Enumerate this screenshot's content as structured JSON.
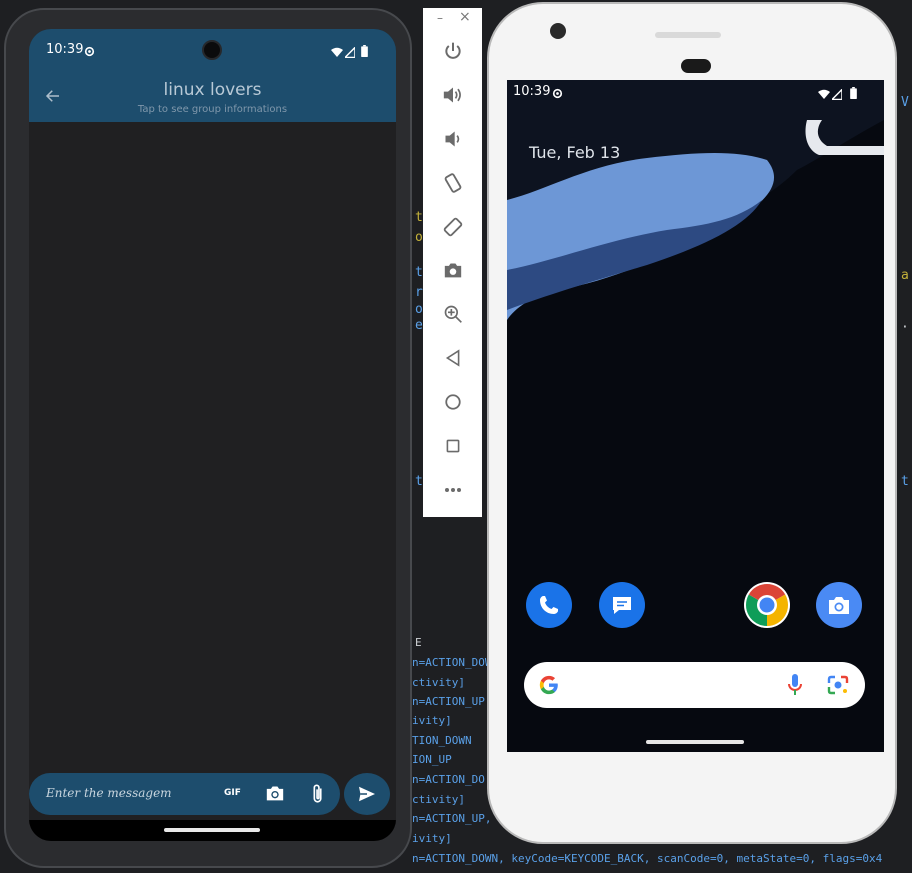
{
  "terminal": {
    "lines": [
      "E",
      "n=ACTION_DOWN",
      "ctivity]",
      "n=ACTION_UP",
      "ivity]",
      "TION_DOWN",
      "ION_UP",
      "n=ACTION_DO",
      "ctivity]",
      "n=ACTION_UP,",
      "ivity]",
      "n=ACTION_DOWN, keyCode=KEYCODE_BACK, scanCode=0, metaState=0, flags=0x4"
    ]
  },
  "chat_app": {
    "status": {
      "time": "10:39"
    },
    "group_name": "linux lovers",
    "group_subtitle": "Tap to see group informations",
    "input_placeholder": "Enter the messagem",
    "gif_label": "GIF"
  },
  "emulator_toolbar": {
    "minimize": "–",
    "close": "×",
    "buttons": [
      "power",
      "volume-up",
      "volume-down",
      "rotate-left",
      "rotate-right",
      "screenshot",
      "zoom",
      "back",
      "home",
      "overview",
      "more"
    ]
  },
  "home_screen": {
    "status": {
      "time": "10:39"
    },
    "date": "Tue, Feb 13",
    "dock": [
      "Phone",
      "Messages",
      "Chrome",
      "Camera"
    ]
  },
  "colors": {
    "appbar": "#1d4d6d",
    "chat_background": "#202022",
    "toolbar_icons": "#6b6b6b"
  }
}
